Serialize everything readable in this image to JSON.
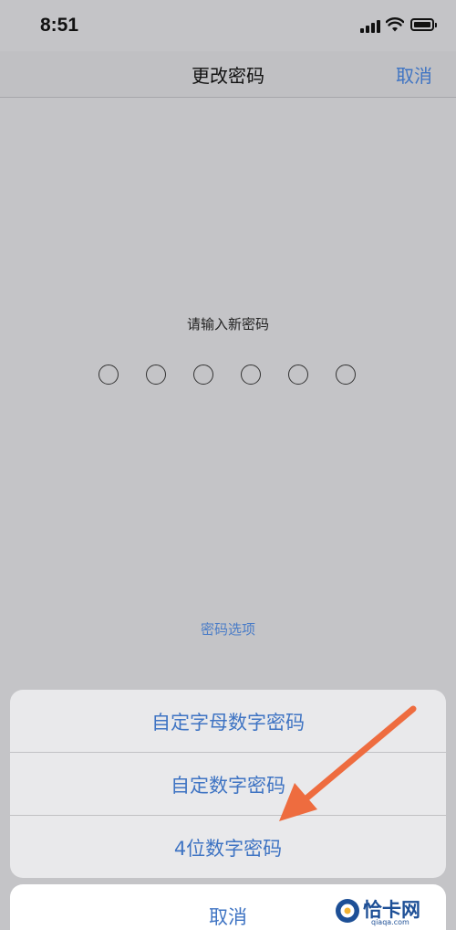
{
  "status_bar": {
    "time": "8:51"
  },
  "nav": {
    "title": "更改密码",
    "cancel_label": "取消"
  },
  "passcode": {
    "prompt": "请输入新密码",
    "digits": 6,
    "entered": 0
  },
  "options_link": "密码选项",
  "action_sheet": {
    "options": [
      {
        "label": "自定字母数字密码"
      },
      {
        "label": "自定数字密码"
      },
      {
        "label": "4位数字密码"
      }
    ],
    "cancel_label": "取消"
  },
  "watermark": {
    "text": "恰卡网",
    "sub": "qiaqa.com"
  },
  "colors": {
    "accent": "#3f74c3",
    "arrow": "#ee6c3f",
    "background": "#c4c4c7"
  }
}
